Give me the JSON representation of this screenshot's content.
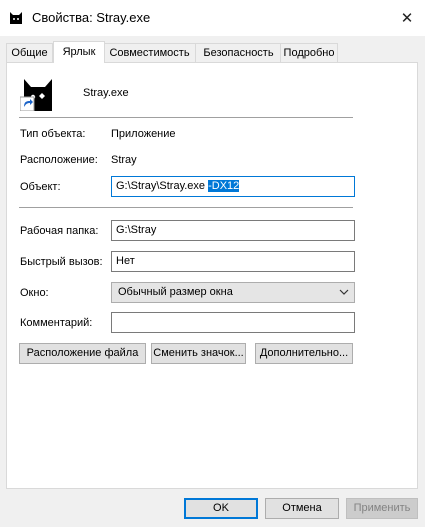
{
  "window": {
    "title": "Свойства: Stray.exe",
    "close_glyph": "✕"
  },
  "tabs": [
    {
      "label": "Общие",
      "active": false
    },
    {
      "label": "Ярлык",
      "active": true
    },
    {
      "label": "Совместимость",
      "active": false
    },
    {
      "label": "Безопасность",
      "active": false
    },
    {
      "label": "Подробно",
      "active": false
    }
  ],
  "shortcut": {
    "name": "Stray.exe",
    "type_label": "Тип объекта:",
    "type_value": "Приложение",
    "location_label": "Расположение:",
    "location_value": "Stray",
    "target_label": "Объект:",
    "target_value_plain": "G:\\Stray\\Stray.exe ",
    "target_value_selected": "-DX12",
    "start_in_label": "Рабочая папка:",
    "start_in_value": "G:\\Stray",
    "hotkey_label": "Быстрый вызов:",
    "hotkey_value": "Нет",
    "run_label": "Окно:",
    "run_value": "Обычный размер окна",
    "comment_label": "Комментарий:",
    "comment_value": ""
  },
  "panel_buttons": {
    "open_location": "Расположение файла",
    "change_icon": "Сменить значок...",
    "advanced": "Дополнительно..."
  },
  "dialog_buttons": {
    "ok": "OK",
    "cancel": "Отмена",
    "apply": "Применить"
  },
  "colors": {
    "accent": "#0078d7",
    "window_bg": "#f0f0f0",
    "panel_bg": "#ffffff"
  },
  "icons": {
    "app": "stray-cat-icon",
    "shortcut_overlay": "shortcut-arrow-icon",
    "close": "close-icon",
    "dropdown": "chevron-down-icon"
  }
}
